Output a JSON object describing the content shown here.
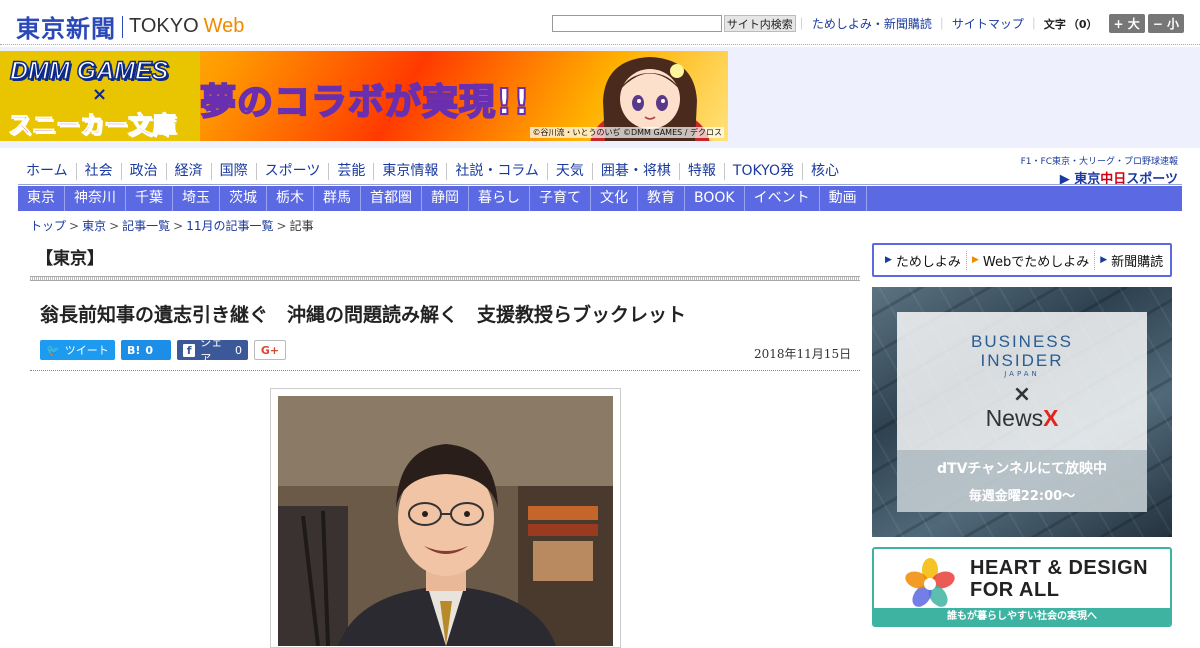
{
  "header": {
    "logo_jp": "東京新聞",
    "logo_tokyo": "TOKYO",
    "logo_web": "Web",
    "search_button": "サイト内検索",
    "links": [
      "ためしよみ・新聞購読",
      "サイトマップ"
    ],
    "font_size_label": "文字",
    "font_size_count": "（0）",
    "font_larger": "+ 大",
    "font_smaller": "− 小"
  },
  "banner": {
    "dmm": "DMM GAMES",
    "x": "×",
    "sneaker": "スニーカー文庫",
    "slogan": "夢のコラボが実現!!",
    "credit": "©谷川流・いとうのいぢ ©DMM GAMES / デクロス"
  },
  "nav_primary": [
    "ホーム",
    "社会",
    "政治",
    "経済",
    "国際",
    "スポーツ",
    "芸能",
    "東京情報",
    "社説・コラム",
    "天気",
    "囲碁・将棋",
    "特報",
    "TOKYO発",
    "核心"
  ],
  "chunichi": {
    "subtitle": "F1・FC東京・大リーグ・プロ野球速報",
    "prefix": "東京",
    "red": "中日",
    "suffix": "スポーツ"
  },
  "nav_regional": [
    "東京",
    "神奈川",
    "千葉",
    "埼玉",
    "茨城",
    "栃木",
    "群馬",
    "首都圏",
    "静岡",
    "暮らし",
    "子育て",
    "文化",
    "教育",
    "BOOK",
    "イベント",
    "動画"
  ],
  "breadcrumb": {
    "items": [
      "トップ",
      "東京",
      "記事一覧",
      "11月の記事一覧"
    ],
    "separator": ">",
    "current": "記事"
  },
  "article": {
    "section": "【東京】",
    "title": "翁長前知事の遺志引き継ぐ　沖縄の問題読み解く　支援教授らブックレット",
    "date": "2018年11月15日",
    "social": {
      "tweet_icon": "🐦",
      "tweet": "ツイート",
      "hatena_icon": "B!",
      "hatena_count": "0",
      "fb_icon": "f",
      "fb_label": "シェア",
      "fb_count": "0",
      "gplus": "G+"
    }
  },
  "sidebar": {
    "links": [
      "ためしよみ",
      "Webでためしよみ",
      "新聞購読"
    ]
  },
  "ad_bi": {
    "brand_line1": "BUSINESS",
    "brand_line2": "INSIDER",
    "japan": "JAPAN",
    "x": "×",
    "newsx_main": "News",
    "newsx_x": "X",
    "dtv": "dTVチャンネルにて放映中",
    "weekly": "毎週金曜22:00〜"
  },
  "ad_hd": {
    "title_line1": "HEART & DESIGN",
    "title_line2": "FOR ALL",
    "tagline": "誰もが暮らしやすい社会の実現へ"
  },
  "colors": {
    "brand_blue": "#2a48b8",
    "nav_band": "#5b69e2",
    "link": "#1a3a9e",
    "web_orange": "#f08a00",
    "hd_teal": "#3fb3a1"
  },
  "icons": [
    "tweet-bird-icon",
    "hatena-bookmark-icon",
    "facebook-icon",
    "google-plus-icon",
    "arrow-right-icon"
  ]
}
